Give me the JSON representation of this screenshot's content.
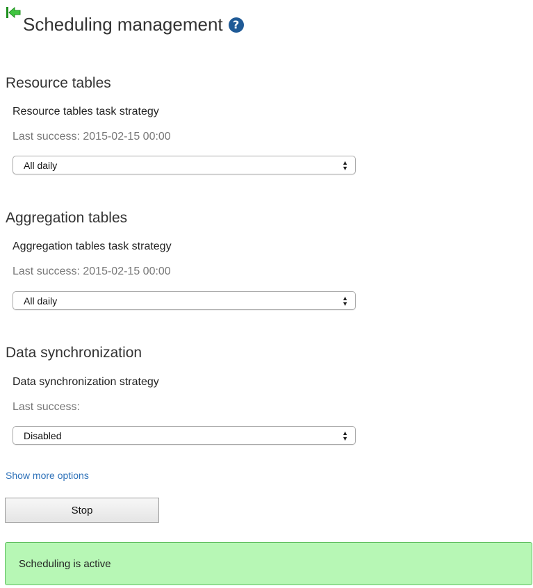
{
  "header": {
    "title": "Scheduling management",
    "help_icon_label": "?",
    "icon_names": [
      "back-arrow-icon",
      "help-icon"
    ],
    "colors": {
      "back_arrow": "#22aa22",
      "help": "#1f5a96"
    }
  },
  "sections": [
    {
      "title": "Resource tables",
      "strategy_label": "Resource tables task strategy",
      "last_success": "Last success: 2015-02-15 00:00",
      "selected": "All daily"
    },
    {
      "title": "Aggregation tables",
      "strategy_label": "Aggregation tables task strategy",
      "last_success": "Last success: 2015-02-15 00:00",
      "selected": "All daily"
    },
    {
      "title": "Data synchronization",
      "strategy_label": "Data synchronization strategy",
      "last_success": "Last success:",
      "selected": "Disabled"
    }
  ],
  "show_more_link": "Show more options",
  "stop_button": "Stop",
  "status": {
    "text": "Scheduling is active",
    "colors": {
      "background": "#b7f7b5",
      "border": "#5fbf5f"
    }
  }
}
